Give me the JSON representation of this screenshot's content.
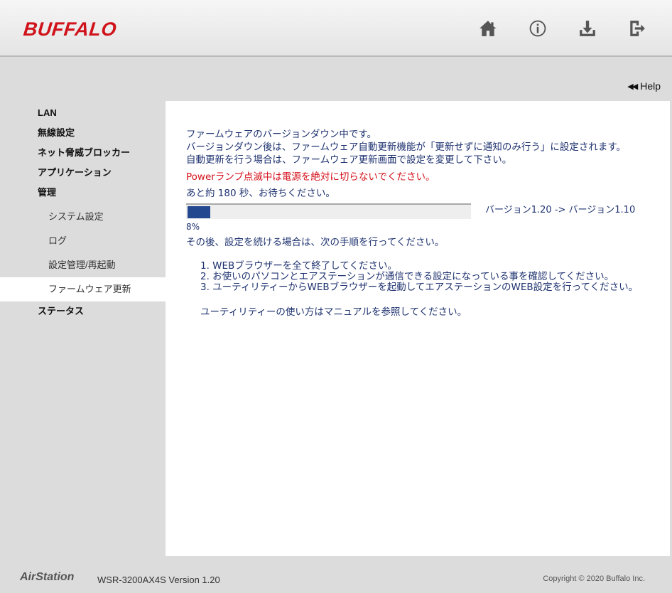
{
  "header": {
    "logo": "BUFFALO",
    "icons": [
      "home-icon",
      "info-icon",
      "download-icon",
      "logout-icon"
    ]
  },
  "help": {
    "label": "Help"
  },
  "sidebar": {
    "items": [
      {
        "label": "LAN"
      },
      {
        "label": "無線設定"
      },
      {
        "label": "ネット脅威ブロッカー"
      },
      {
        "label": "アプリケーション"
      },
      {
        "label": "管理"
      }
    ],
    "sub_items": [
      {
        "label": "システム設定"
      },
      {
        "label": "ログ"
      },
      {
        "label": "設定管理/再起動"
      },
      {
        "label": "ファームウェア更新"
      }
    ],
    "status": {
      "label": "ステータス"
    }
  },
  "content": {
    "line1": "ファームウェアのバージョンダウン中です。",
    "line2": "バージョンダウン後は、ファームウェア自動更新機能が「更新せずに通知のみ行う」に設定されます。",
    "line3": "自動更新を行う場合は、ファームウェア更新画面で設定を変更して下さい。",
    "warning": "Powerランプ点滅中は電源を絶対に切らないでください。",
    "wait": "あと約 180 秒、お待ちください。",
    "progress_percent": 8,
    "progress_label": "8%",
    "version_change": "バージョン1.20 -> バージョン1.10",
    "after": "その後、設定を続ける場合は、次の手順を行ってください。",
    "steps": [
      "1. WEBブラウザーを全て終了してください。",
      "2. お使いのパソコンとエアステーションが通信できる設定になっている事を確認してください。",
      "3. ユーティリティーからWEBブラウザーを起動してエアステーションのWEB設定を行ってください。"
    ],
    "manual_note": "ユーティリティーの使い方はマニュアルを参照してください。"
  },
  "footer": {
    "brand": "AirStation",
    "model": "WSR-3200AX4S   Version 1.20",
    "copyright": "Copyright © 2020 Buffalo Inc."
  },
  "colors": {
    "brand_red": "#d0121b",
    "text_blue": "#1f3370",
    "progress_fill": "#23488f",
    "warning_red": "#d4121b"
  }
}
